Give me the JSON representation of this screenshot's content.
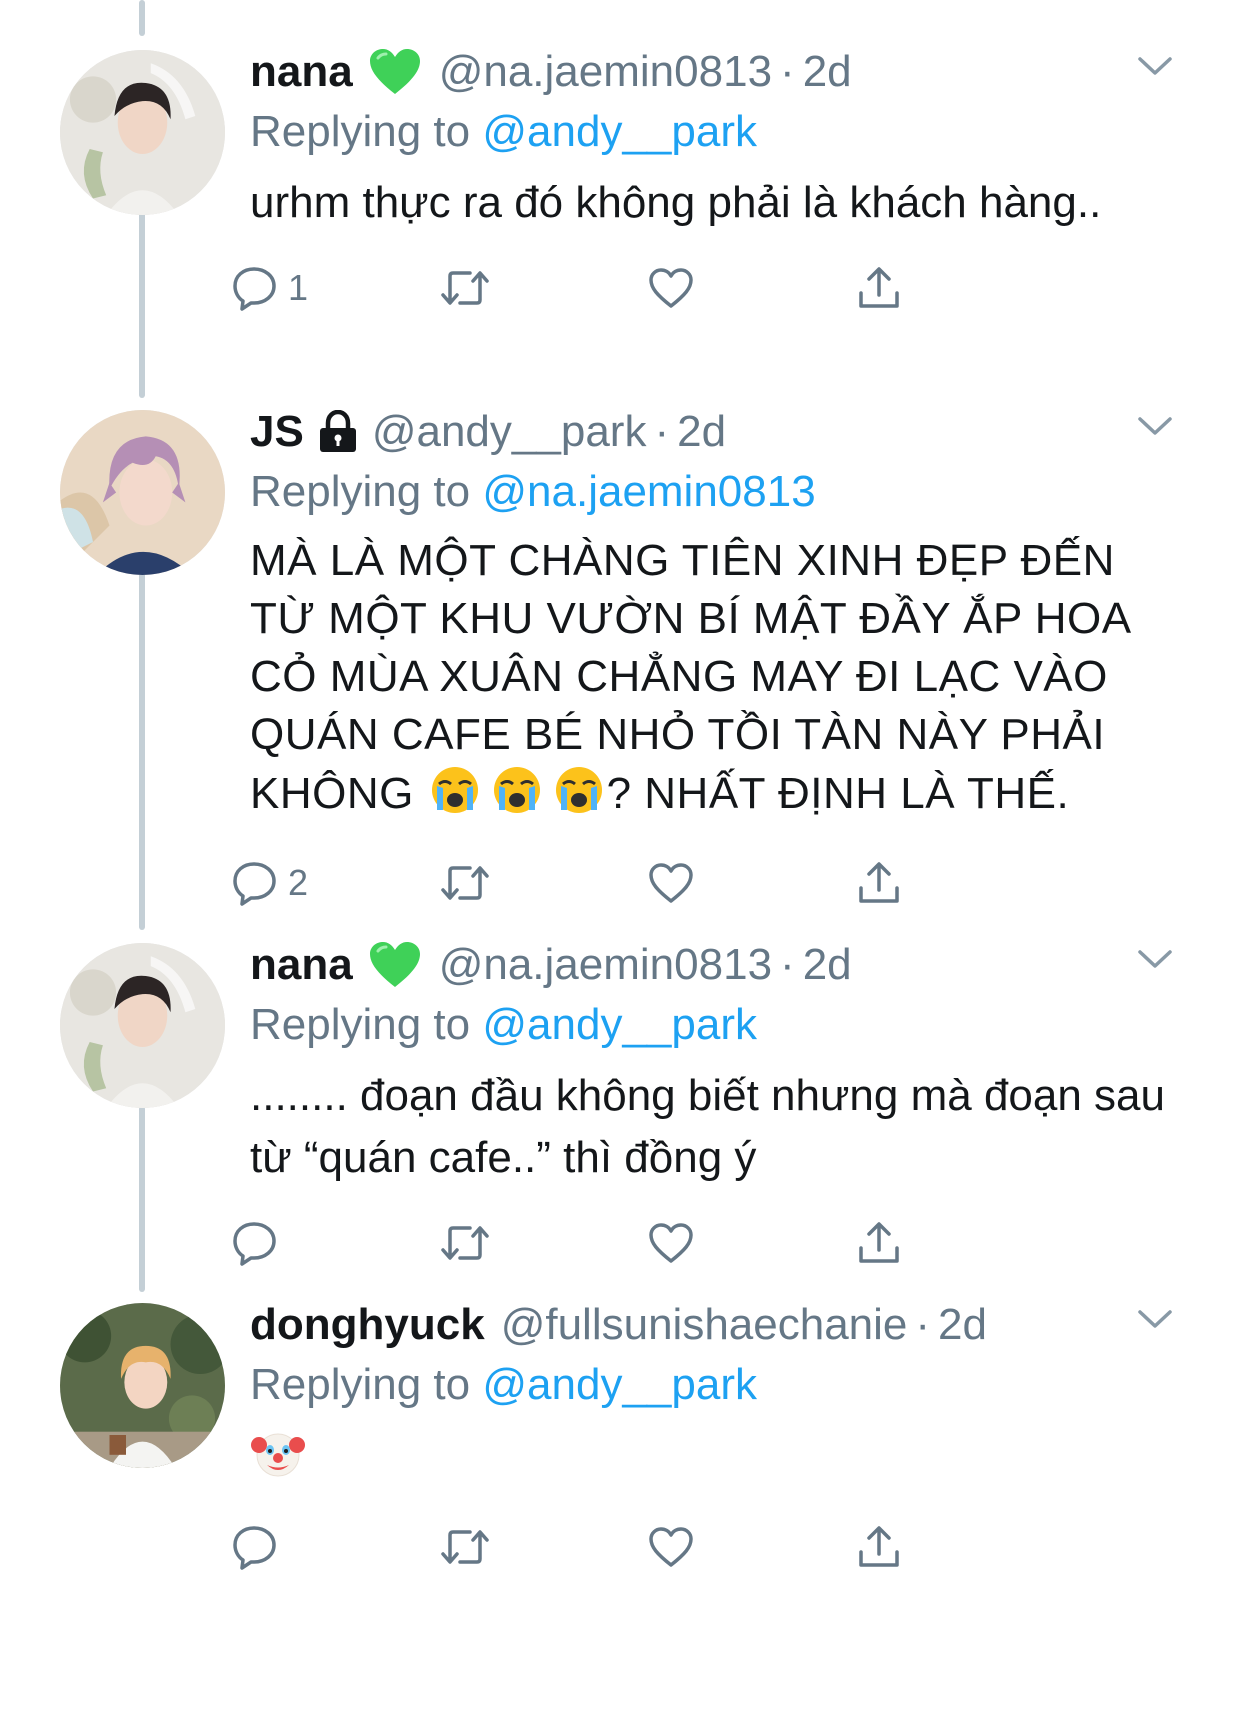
{
  "tweets": [
    {
      "display_name": "nana",
      "badge_icon": "green-heart-icon",
      "handle": "@na.jaemin0813",
      "dot": "·",
      "time": "2d",
      "replying_prefix": "Replying to ",
      "replying_to": "@andy__park",
      "text": "urhm thực ra đó không phải là khách hàng..",
      "reply_count": "1",
      "retweet_count": "",
      "like_count": ""
    },
    {
      "display_name": "JS",
      "badge_icon": "lock-icon",
      "handle": "@andy__park",
      "dot": "·",
      "time": "2d",
      "replying_prefix": "Replying to ",
      "replying_to": "@na.jaemin0813",
      "text_before_emoji": "MÀ LÀ MỘT CHÀNG TIÊN XINH ĐẸP ĐẾN TỪ MỘT KHU VƯỜN BÍ MẬT ĐẦY ẮP HOA CỎ MÙA XUÂN CHẲNG MAY ĐI LẠC VÀO QUÁN CAFE BÉ NHỎ TỒI TÀN NÀY PHẢI KHÔNG ",
      "emoji": "crying-face-emoji",
      "text_after_emoji": "? NHẤT ĐỊNH LÀ THẾ.",
      "reply_count": "2",
      "retweet_count": "",
      "like_count": ""
    },
    {
      "display_name": "nana",
      "badge_icon": "green-heart-icon",
      "handle": "@na.jaemin0813",
      "dot": "·",
      "time": "2d",
      "replying_prefix": "Replying to ",
      "replying_to": "@andy__park",
      "text": "........ đoạn đầu không biết nhưng mà đoạn sau từ “quán cafe..” thì đồng ý",
      "reply_count": "",
      "retweet_count": "",
      "like_count": ""
    },
    {
      "display_name": "donghyuck",
      "handle": "@fullsunishaechanie",
      "dot": "·",
      "time": "2d",
      "replying_prefix": "Replying to ",
      "replying_to": "@andy__park",
      "emoji": "clown-face-emoji",
      "reply_count": "",
      "retweet_count": "",
      "like_count": ""
    }
  ],
  "colors": {
    "text": "#14171a",
    "secondary": "#657786",
    "link": "#1da1f2",
    "thread_line": "#c4cfd6",
    "green_heart": "#3fd158"
  }
}
